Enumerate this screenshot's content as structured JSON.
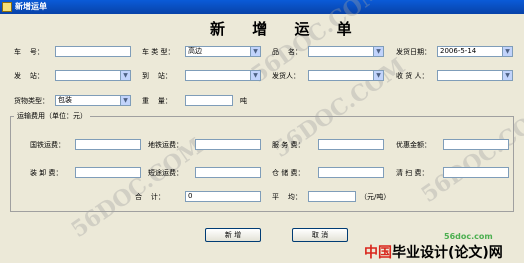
{
  "window": {
    "title": "新增运单"
  },
  "form_title": "新 增 运 单",
  "row1": {
    "car_no_label": "车    号：",
    "car_type_label": "车 类 型：",
    "car_type_value": "高边",
    "product_label": "品    名：",
    "ship_date_label": "发货日期：",
    "ship_date_value": "2006-5-14"
  },
  "row2": {
    "station_label": "发    站：",
    "arrival_label": "到    站：",
    "shipper_label": "发货人：",
    "receiver_label": "收 货 人："
  },
  "row3": {
    "cargo_type_label": "货物类型：",
    "cargo_type_value": "包装",
    "weight_label": "重    量：",
    "weight_unit": "吨"
  },
  "fees": {
    "legend": "运输费用（单位：元）",
    "national_rail_label": "国铁运费：",
    "local_rail_label": "地铁运费：",
    "service_label": "服 务 费：",
    "discount_label": "优惠金额：",
    "loading_label": "装 卸 费：",
    "short_haul_label": "短途运费：",
    "storage_label": "仓 储 费：",
    "cleaning_label": "清 扫 费：",
    "total_label": "合    计：",
    "total_value": "0",
    "average_label": "平    均：",
    "average_unit": "（元/吨）"
  },
  "buttons": {
    "add": "新  增",
    "cancel": "取  消"
  },
  "watermark": {
    "text": "56DOC.COM"
  },
  "logo": {
    "url": "56doc.com",
    "brand_prefix": "中国",
    "brand_main": "毕业设计(论文)网"
  }
}
